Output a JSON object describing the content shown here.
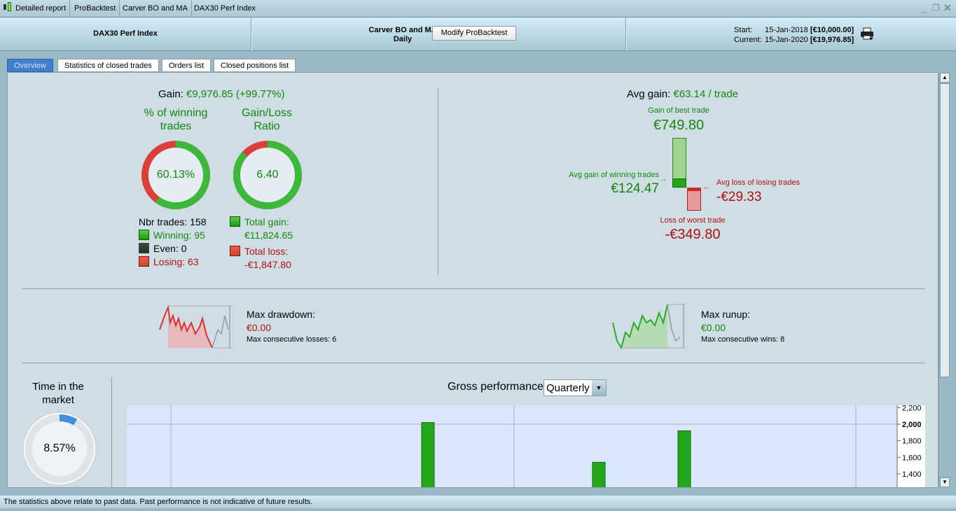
{
  "window": {
    "tabs": [
      "Detailed report",
      "ProBacktest",
      "Carver BO and MA",
      "DAX30 Perf Index"
    ]
  },
  "header": {
    "instrument": "DAX30 Perf Index",
    "strategy": "Carver BO and MA",
    "timeframe": "Daily",
    "modify_label": "Modify ProBacktest",
    "start_label": "Start:",
    "start_date": "15-Jan-2018",
    "start_value": "[€10,000.00]",
    "current_label": "Current:",
    "current_date": "15-Jan-2020",
    "current_value": "[€19,976.85]"
  },
  "tabs": [
    "Overview",
    "Statistics of closed trades",
    "Orders list",
    "Closed positions list"
  ],
  "overview": {
    "gain_label": "Gain:",
    "gain_value": "€9,976.85 (+99.77%)",
    "winning_title": "% of winning trades",
    "winning_pct": "60.13%",
    "winning_fraction": 0.6013,
    "ratio_title": "Gain/Loss Ratio",
    "ratio_value": "6.40",
    "ratio_gain_fraction": 0.865,
    "nbr_trades": "Nbr trades: 158",
    "winning": "Winning: 95",
    "even": "Even: 0",
    "losing": "Losing: 63",
    "total_gain_label": "Total gain:",
    "total_gain": "€11,824.65",
    "total_loss_label": "Total loss:",
    "total_loss": "-€1,847.80",
    "avg_gain_label": "Avg gain:",
    "avg_gain_value": "€63.14 / trade",
    "best_label": "Gain of best trade",
    "best_value": "€749.80",
    "avg_win_label": "Avg gain of winning trades",
    "avg_win_value": "€124.47",
    "avg_loss_label": "Avg loss of losing trades",
    "avg_loss_value": "-€29.33",
    "worst_label": "Loss of worst trade",
    "worst_value": "-€349.80",
    "drawdown_label": "Max drawdown:",
    "drawdown_value": "€0.00",
    "consec_losses": "Max consecutive losses: 6",
    "runup_label": "Max runup:",
    "runup_value": "€0.00",
    "consec_wins": "Max consecutive wins: 8",
    "time_market_title": "Time in the market",
    "time_market_value": "8.57%",
    "time_market_fraction": 0.0857,
    "gross_label": "Gross performance",
    "period": "Quarterly"
  },
  "colors": {
    "green": "#15860f",
    "red": "#b40f0f",
    "accent": "#3f7fd0"
  },
  "chart_data": {
    "type": "bar",
    "title": "Gross performance",
    "ylim": [
      1300,
      2250
    ],
    "yticks": [
      "2,200",
      "2,000",
      "1,800",
      "1,600",
      "1,400"
    ],
    "values": [
      2020,
      1540,
      1920
    ]
  },
  "status": "The statistics above relate to past data. Past performance is not indicative of future results."
}
